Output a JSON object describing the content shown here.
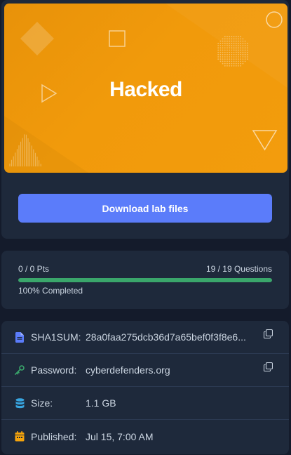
{
  "banner": {
    "title": "Hacked",
    "color": "#f09a0b"
  },
  "download": {
    "label": "Download lab files",
    "color": "#5b7cfa"
  },
  "progress": {
    "points": "0 / 0 Pts",
    "questions": "19 / 19 Questions",
    "completed_label": "100% Completed",
    "fraction": 1.0,
    "color": "#3aa66b"
  },
  "info": {
    "sha1": {
      "label": "SHA1SUM:",
      "value": "28a0faa275dcb36d7a65bef0f3f8e6...",
      "icon": "file-icon"
    },
    "password": {
      "label": "Password:",
      "value": "cyberdefenders.org",
      "icon": "key-icon"
    },
    "size": {
      "label": "Size:",
      "value": "1.1 GB",
      "icon": "database-icon"
    },
    "published": {
      "label": "Published:",
      "value": "Jul 15, 7:00 AM",
      "icon": "calendar-icon"
    }
  }
}
